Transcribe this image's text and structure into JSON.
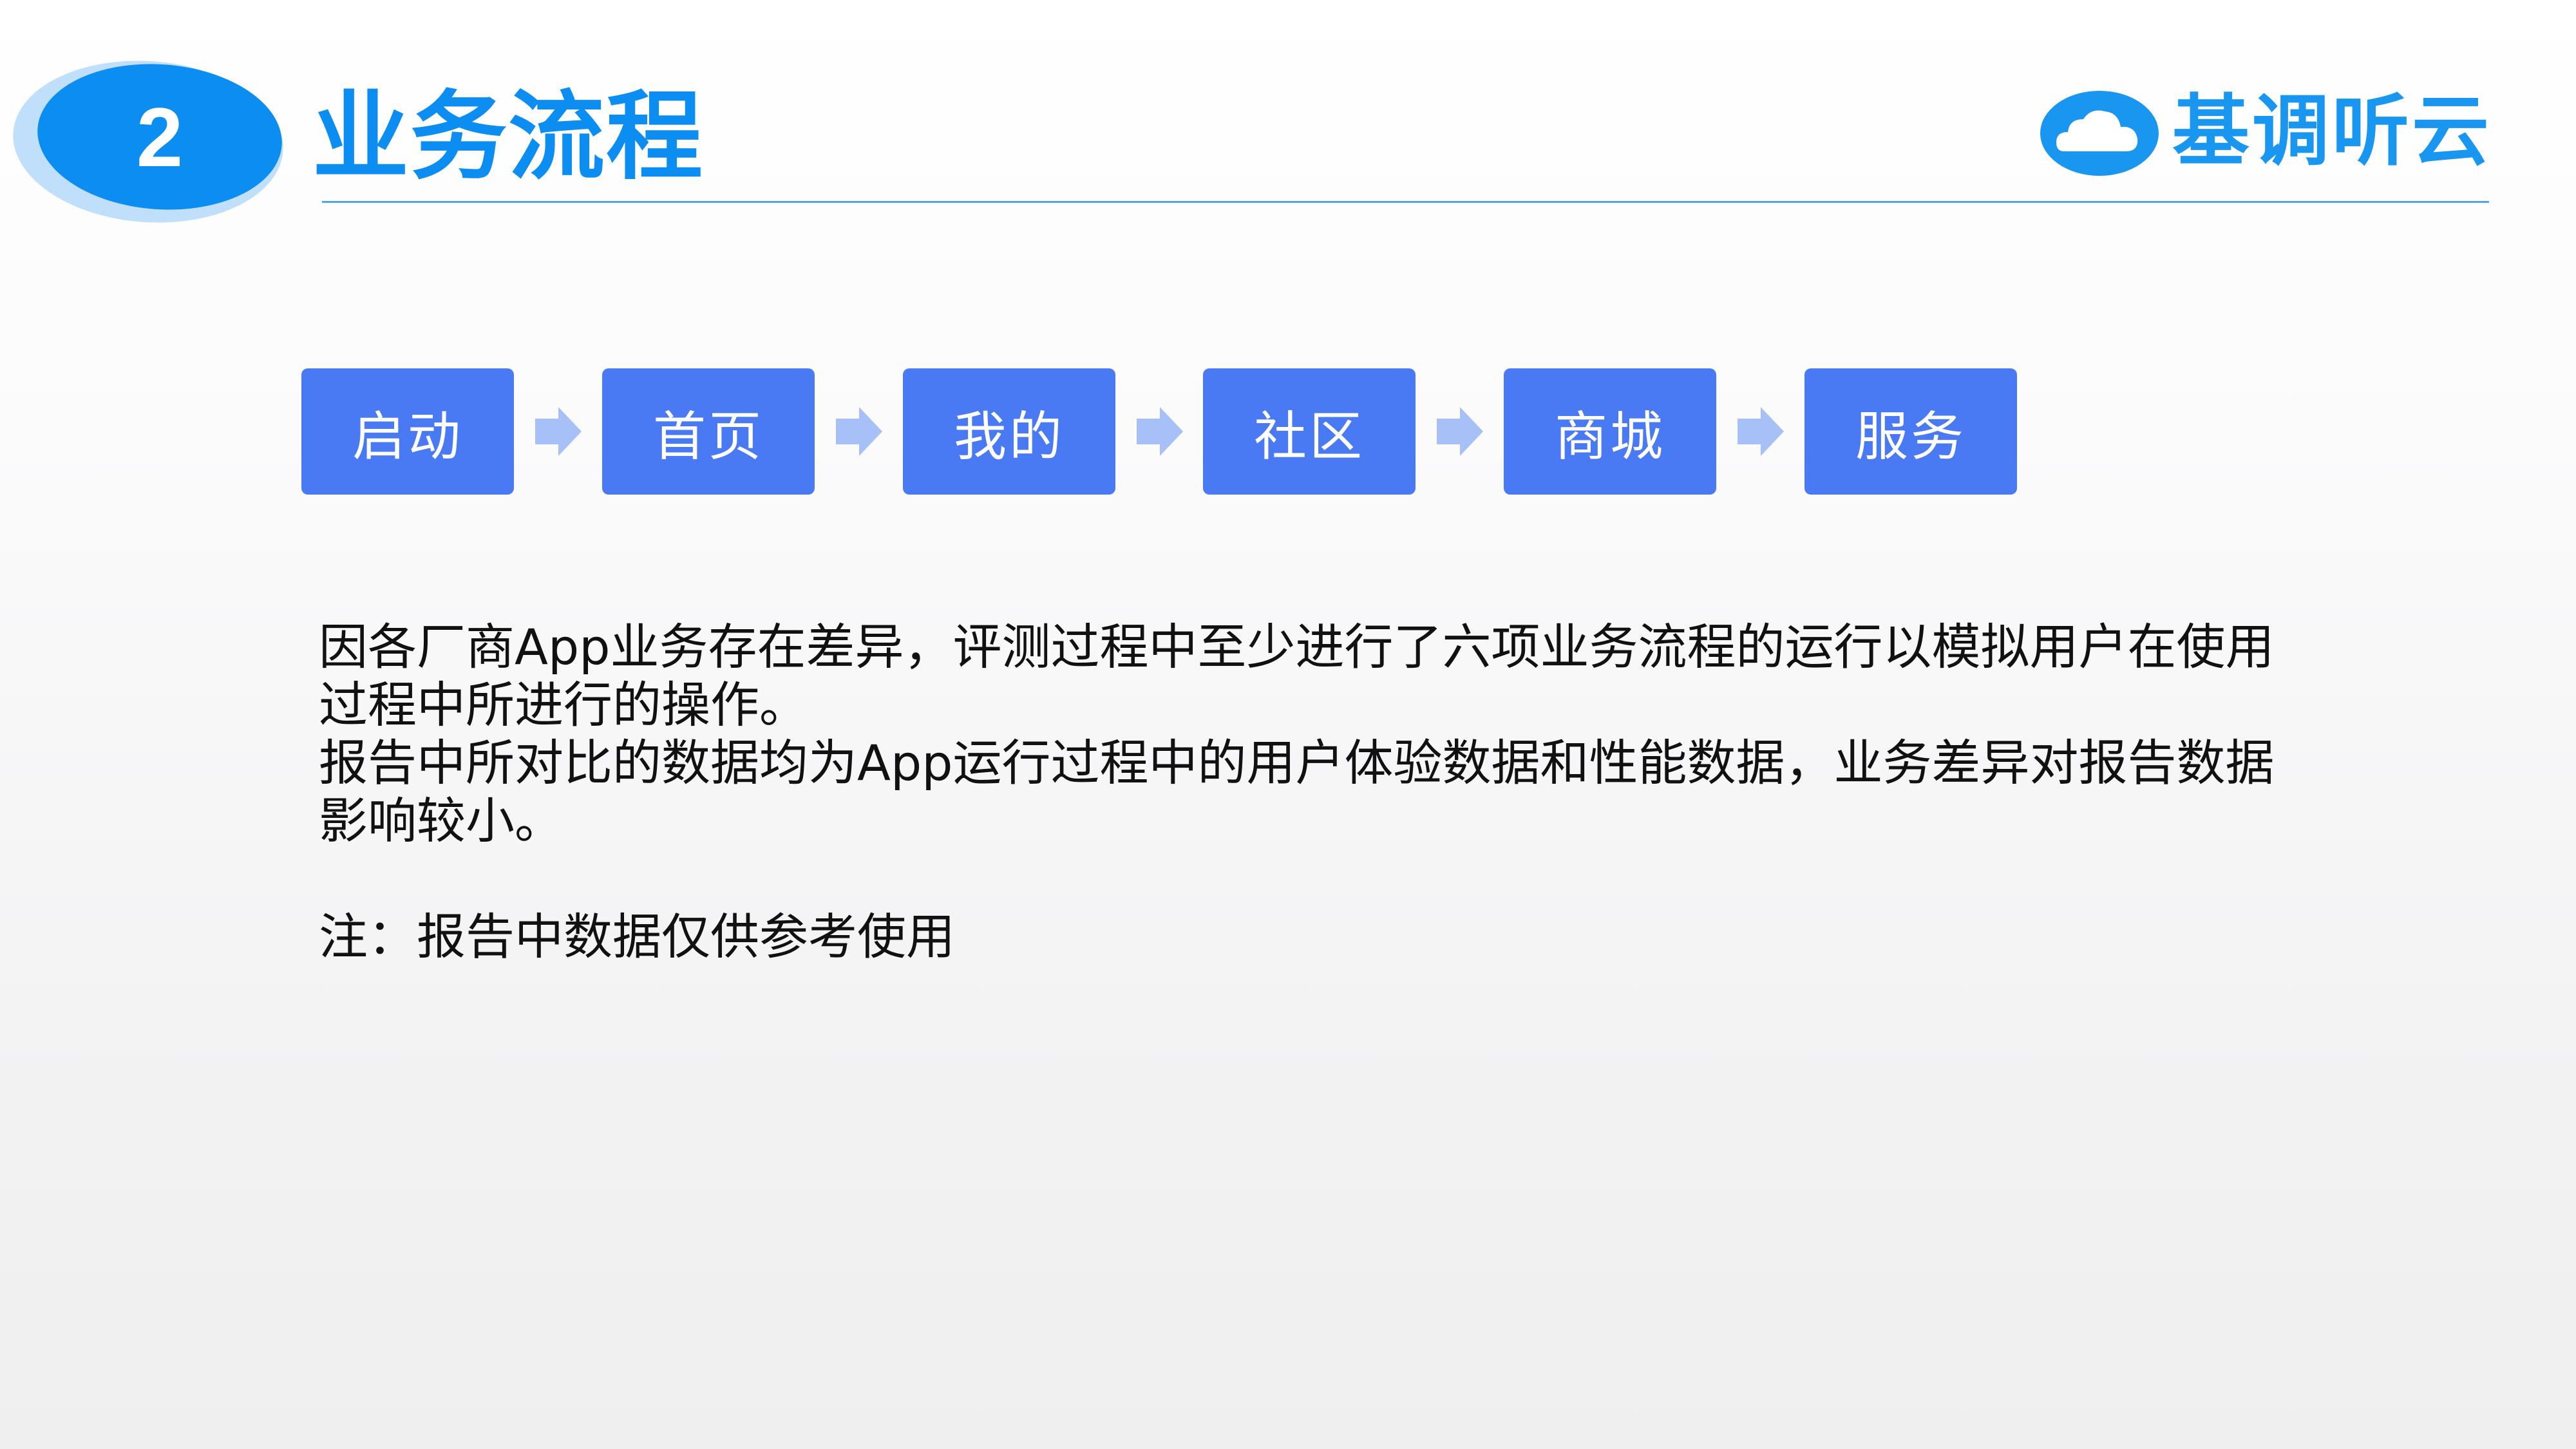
{
  "header": {
    "section_number": "2",
    "title": "业务流程",
    "logo_text": "基调听云"
  },
  "flow": {
    "steps": [
      {
        "label": "启动"
      },
      {
        "label": "首页"
      },
      {
        "label": "我的"
      },
      {
        "label": "社区"
      },
      {
        "label": "商城"
      },
      {
        "label": "服务"
      }
    ]
  },
  "body": {
    "paragraph_1": "因各厂商App业务存在差异，评测过程中至少进行了六项业务流程的运行以模拟用户在使用过程中所进行的操作。",
    "paragraph_2": "报告中所对比的数据均为App运行过程中的用户体验数据和性能数据，业务差异对报告数据影响较小。",
    "note": "注：报告中数据仅供参考使用"
  },
  "colors": {
    "accent_blue": "#0b8df1",
    "step_fill": "#4a7af3",
    "arrow_fill": "#a7c0f7",
    "badge_halo": "#b8dcfb"
  }
}
